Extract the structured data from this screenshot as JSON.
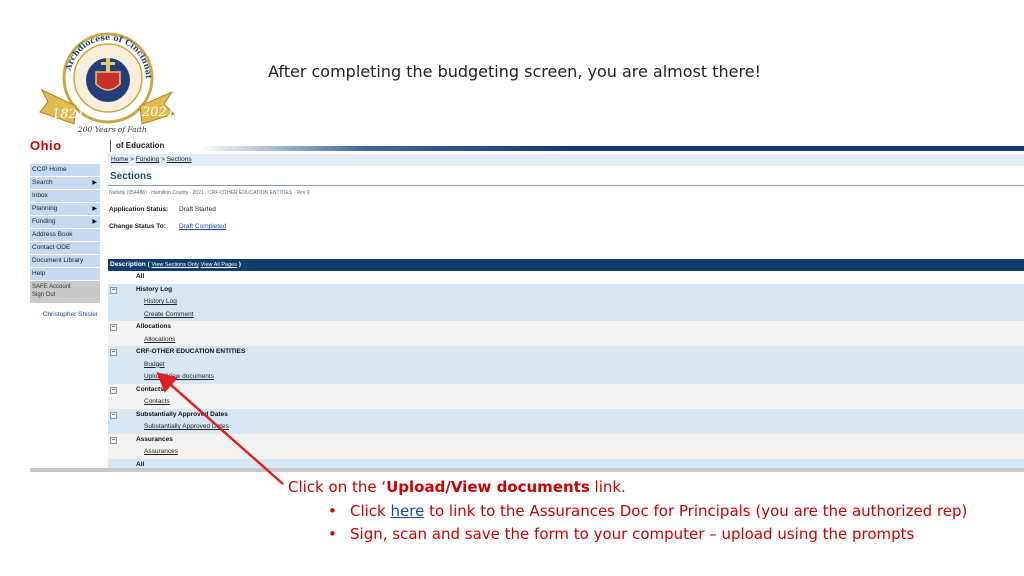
{
  "logo": {
    "ring_text": "Archdiocese of Cincinnati",
    "bottom_text": "200 Years of Faith",
    "year_left": "1821",
    "year_right": "2021"
  },
  "headline": "After completing the budgeting screen, you are almost there!",
  "app": {
    "brand": "Ohio",
    "dept": "of Education"
  },
  "nav": {
    "items": [
      {
        "label": "CCIP Home",
        "arrow": ""
      },
      {
        "label": "Search",
        "arrow": "▶"
      },
      {
        "label": "Inbox",
        "arrow": ""
      },
      {
        "label": "Planning",
        "arrow": "▶"
      },
      {
        "label": "Funding",
        "arrow": "▶"
      },
      {
        "label": "Address Book",
        "arrow": ""
      },
      {
        "label": "Contact ODE",
        "arrow": ""
      },
      {
        "label": "Document Library",
        "arrow": ""
      },
      {
        "label": "Help",
        "arrow": ""
      }
    ],
    "account_line1": "SAFE Account",
    "account_line2": "Sign Out",
    "user": "Christopher Shisler"
  },
  "main": {
    "breadcrumb": [
      "Home",
      "Funding",
      "Sections"
    ],
    "title": "Sections",
    "subinfo": "Nativity (054486) · Hamilton County · 2021 · CRF-OTHER EDUCATION ENTITIES · Rev 0",
    "app_status_label": "Application Status:",
    "app_status_value": "Draft Started",
    "change_status_label": "Change Status To:",
    "change_status_value": "Draft Completed"
  },
  "table": {
    "header_label": "Description",
    "header_link1": "View Sections Only",
    "header_link2": "View All Pages",
    "rows": [
      {
        "type": "all",
        "label": "All",
        "bg": "bg-w"
      },
      {
        "type": "hdr",
        "label": "History Log",
        "bg": "bg-b"
      },
      {
        "type": "link",
        "label": "History Log",
        "bg": "bg-b"
      },
      {
        "type": "link",
        "label": "Create Comment",
        "bg": "bg-b"
      },
      {
        "type": "hdr",
        "label": "Allocations",
        "bg": "bg-g"
      },
      {
        "type": "link",
        "label": "Allocations",
        "bg": "bg-g"
      },
      {
        "type": "hdr",
        "label": "CRF-OTHER EDUCATION ENTITIES",
        "bg": "bg-b"
      },
      {
        "type": "link",
        "label": "Budget",
        "bg": "bg-b"
      },
      {
        "type": "link",
        "label": "Upload/View documents",
        "bg": "bg-b"
      },
      {
        "type": "hdr",
        "label": "Contacts",
        "bg": "bg-g"
      },
      {
        "type": "link",
        "label": "Contacts",
        "bg": "bg-g"
      },
      {
        "type": "hdr",
        "label": "Substantially Approved Dates",
        "bg": "bg-b"
      },
      {
        "type": "link",
        "label": "Substantially Approved Dates",
        "bg": "bg-b"
      },
      {
        "type": "hdr",
        "label": "Assurances",
        "bg": "bg-g"
      },
      {
        "type": "link",
        "label": "Assurances",
        "bg": "bg-g"
      },
      {
        "type": "all",
        "label": "All",
        "bg": "bg-b"
      }
    ]
  },
  "instructions": {
    "pre": "Click on the ‘",
    "bold": "Upload/View documents",
    "post": " link.",
    "bullet1_pre": "Click ",
    "bullet1_link": "here",
    "bullet1_post": " to link to the Assurances Doc for Principals (you are the authorized rep)",
    "bullet2": "Sign, scan and save the form to your computer – upload using the prompts"
  },
  "colors": {
    "accent_red": "#cc0000",
    "nav_blue": "#0f3d70",
    "row_blue": "#d6e6f3"
  }
}
